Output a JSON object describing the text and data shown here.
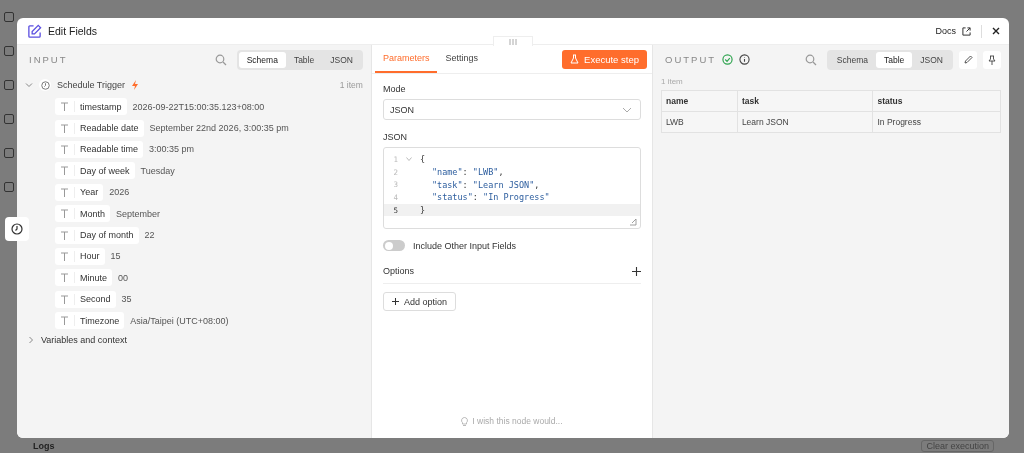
{
  "background": {
    "logs_label": "Logs",
    "clear_button": "Clear execution"
  },
  "modal": {
    "title": "Edit Fields",
    "docs_link": "Docs"
  },
  "input": {
    "heading": "INPUT",
    "view_tabs": [
      {
        "label": "Schema",
        "selected": true
      },
      {
        "label": "Table",
        "selected": false
      },
      {
        "label": "JSON",
        "selected": false
      }
    ],
    "node": {
      "name": "Schedule Trigger",
      "expanded": true,
      "count": "1 item",
      "fields": [
        {
          "name": "timestamp",
          "value": "2026-09-22T15:00:35.123+08:00"
        },
        {
          "name": "Readable date",
          "value": "September 22nd 2026, 3:00:35 pm"
        },
        {
          "name": "Readable time",
          "value": "3:00:35 pm"
        },
        {
          "name": "Day of week",
          "value": "Tuesday"
        },
        {
          "name": "Year",
          "value": "2026"
        },
        {
          "name": "Month",
          "value": "September"
        },
        {
          "name": "Day of month",
          "value": "22"
        },
        {
          "name": "Hour",
          "value": "15"
        },
        {
          "name": "Minute",
          "value": "00"
        },
        {
          "name": "Second",
          "value": "35"
        },
        {
          "name": "Timezone",
          "value": "Asia/Taipei (UTC+08:00)"
        }
      ]
    },
    "variables": {
      "label": "Variables and context",
      "expanded": false
    }
  },
  "parameters": {
    "tabs": [
      {
        "label": "Parameters",
        "selected": true
      },
      {
        "label": "Settings",
        "selected": false
      }
    ],
    "execute_button": "Execute step",
    "mode": {
      "label": "Mode",
      "value": "JSON"
    },
    "json": {
      "label": "JSON",
      "lines": [
        {
          "number": "1",
          "kind": "brace",
          "current": false,
          "tokens": [
            {
              "kind": "punct",
              "text": "{"
            }
          ]
        },
        {
          "number": "2",
          "kind": "member",
          "current": false,
          "tokens": [
            {
              "kind": "key",
              "text": "\"name\""
            },
            {
              "kind": "punct",
              "text": ": "
            },
            {
              "kind": "string",
              "text": "\"LWB\""
            },
            {
              "kind": "punct",
              "text": ","
            }
          ]
        },
        {
          "number": "3",
          "kind": "member",
          "current": false,
          "tokens": [
            {
              "kind": "key",
              "text": "\"task\""
            },
            {
              "kind": "punct",
              "text": ": "
            },
            {
              "kind": "string",
              "text": "\"Learn JSON\""
            },
            {
              "kind": "punct",
              "text": ","
            }
          ]
        },
        {
          "number": "4",
          "kind": "member",
          "current": false,
          "tokens": [
            {
              "kind": "key",
              "text": "\"status\""
            },
            {
              "kind": "punct",
              "text": ": "
            },
            {
              "kind": "string",
              "text": "\"In Progress\""
            }
          ]
        },
        {
          "number": "5",
          "kind": "brace",
          "current": true,
          "tokens": [
            {
              "kind": "punct",
              "text": "}"
            }
          ]
        }
      ]
    },
    "include_other": {
      "label": "Include Other Input Fields",
      "on": false
    },
    "options": {
      "label": "Options",
      "add_button": "Add option"
    },
    "feedback": "I wish this node would..."
  },
  "output": {
    "heading": "OUTPUT",
    "success": true,
    "view_tabs": [
      {
        "label": "Schema",
        "selected": false
      },
      {
        "label": "Table",
        "selected": true
      },
      {
        "label": "JSON",
        "selected": false
      }
    ],
    "count": "1 item",
    "table": {
      "columns": [
        "name",
        "task",
        "status"
      ],
      "rows": [
        [
          "LWB",
          "Learn JSON",
          "In Progress"
        ]
      ]
    }
  }
}
